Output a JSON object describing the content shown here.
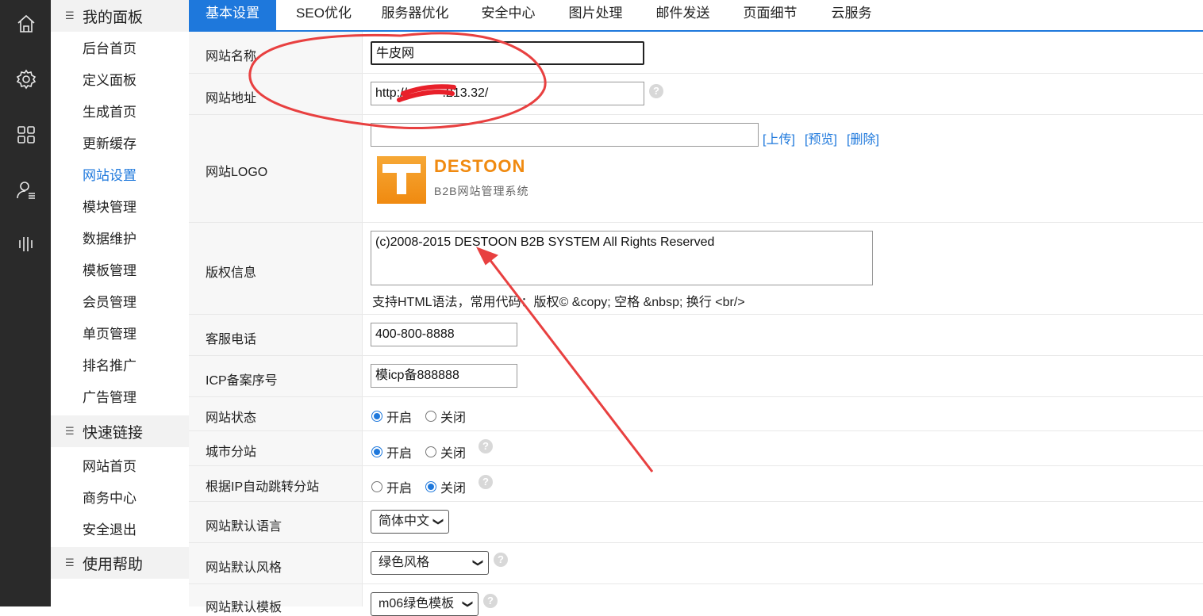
{
  "icons": [
    "home-icon",
    "gear-icon",
    "grid-icon",
    "user-list-icon",
    "bars-icon"
  ],
  "sidebar": {
    "section1": "我的面板",
    "items": [
      "后台首页",
      "定义面板",
      "生成首页",
      "更新缓存",
      "网站设置",
      "模块管理",
      "数据维护",
      "模板管理",
      "会员管理",
      "单页管理",
      "排名推广",
      "广告管理"
    ],
    "section2": "快速链接",
    "links": [
      "网站首页",
      "商务中心",
      "安全退出"
    ],
    "section3": "使用帮助"
  },
  "tabs": [
    "基本设置",
    "SEO优化",
    "服务器优化",
    "安全中心",
    "图片处理",
    "邮件发送",
    "页面细节",
    "云服务"
  ],
  "form": {
    "site_name_label": "网站名称",
    "site_name_value": "牛皮网",
    "site_url_label": "网站地址",
    "site_url_value": "http://          .213.32/",
    "logo_label": "网站LOGO",
    "logo_upload": "[上传]",
    "logo_preview": "[预览]",
    "logo_delete": "[删除]",
    "logo_brand": "DESTOON",
    "logo_sub": "B2B网站管理系统",
    "copyright_label": "版权信息",
    "copyright_value": "(c)2008-2015 DESTOON B2B SYSTEM All Rights Reserved",
    "copyright_tip": "支持HTML语法，常用代码：版权© &copy; 空格 &nbsp; 换行 <br/>",
    "phone_label": "客服电话",
    "phone_value": "400-800-8888",
    "icp_label": "ICP备案序号",
    "icp_value": "模icp备888888",
    "status_label": "网站状态",
    "city_label": "城市分站",
    "ip_label": "根据IP自动跳转分站",
    "on": "开启",
    "off": "关闭",
    "lang_label": "网站默认语言",
    "lang_value": "简体中文",
    "style_label": "网站默认风格",
    "style_value": "绿色风格",
    "tpl_label": "网站默认模板",
    "tpl_value": "m06绿色模板",
    "help": "?"
  },
  "colors": {
    "accent": "#1e78dc",
    "annotation": "#e84040",
    "iconbar": "#2a2a2a"
  }
}
